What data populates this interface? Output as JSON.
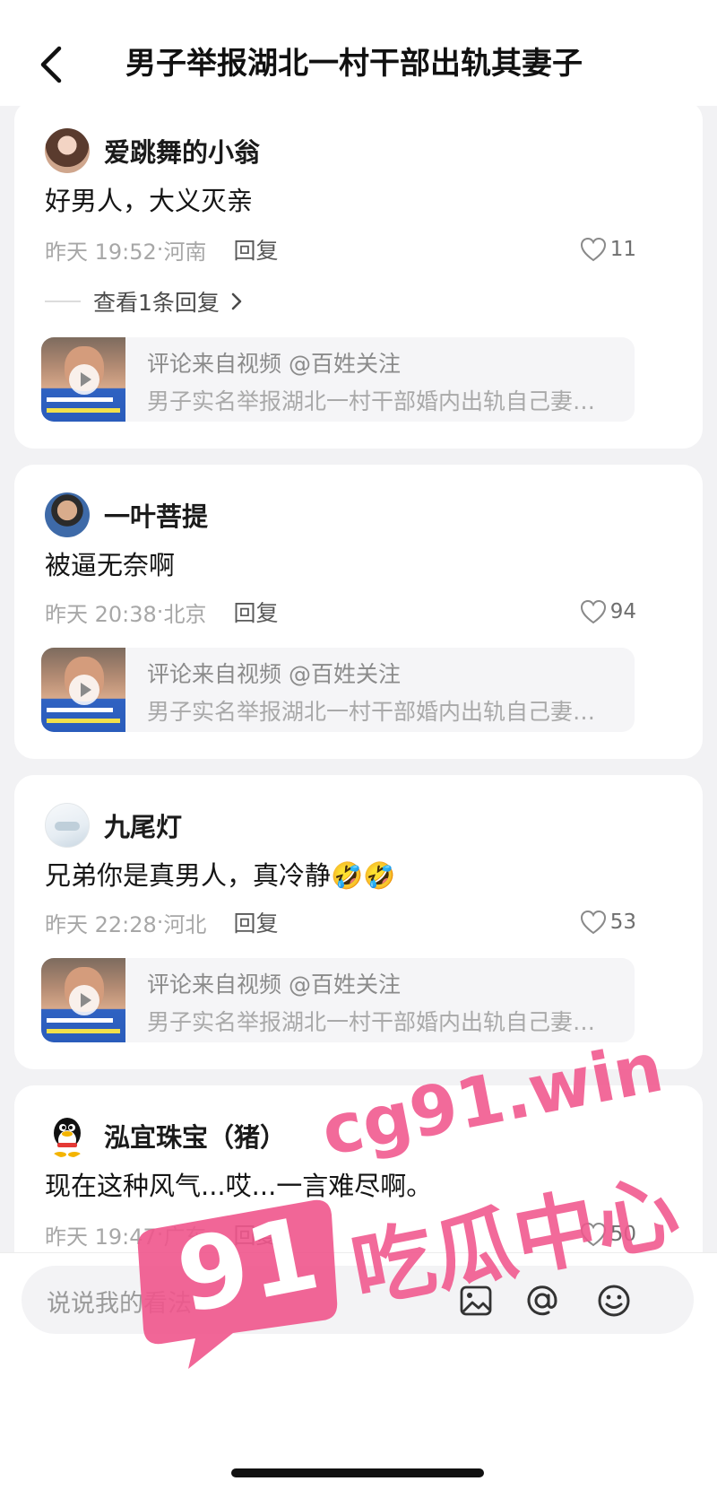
{
  "header": {
    "title": "男子举报湖北一村干部出轨其妻子"
  },
  "comments": [
    {
      "username": "爱跳舞的小翁",
      "text": "好男人，大义灭亲",
      "time": "昨天 19:52",
      "location": "河南",
      "reply_label": "回复",
      "likes": "11",
      "view_replies": "查看1条回复",
      "video_source": "评论来自视频 @百姓关注",
      "video_title": "男子实名举报湖北一村干部婚内出轨自己妻…"
    },
    {
      "username": "一叶菩提",
      "text": "被逼无奈啊",
      "time": "昨天 20:38",
      "location": "北京",
      "reply_label": "回复",
      "likes": "94",
      "video_source": "评论来自视频 @百姓关注",
      "video_title": "男子实名举报湖北一村干部婚内出轨自己妻…"
    },
    {
      "username": "九尾灯",
      "text": "兄弟你是真男人，真冷静🤣🤣",
      "time": "昨天 22:28",
      "location": "河北",
      "reply_label": "回复",
      "likes": "53",
      "video_source": "评论来自视频 @百姓关注",
      "video_title": "男子实名举报湖北一村干部婚内出轨自己妻…"
    },
    {
      "username": "泓宜珠宝（猪）",
      "text": "现在这种风气...哎...一言难尽啊。",
      "time": "昨天 19:47",
      "location": "广东",
      "reply_label": "回复",
      "likes": "50"
    }
  ],
  "bottom": {
    "placeholder": "说说我的看法"
  },
  "watermark": {
    "site": "cg91.win",
    "badge": "91",
    "text": "吃瓜中心"
  },
  "colors": {
    "background": "#f2f2f4",
    "card": "#ffffff",
    "watermark": "#f0558c"
  },
  "icons": [
    "back-arrow-icon",
    "heart-icon",
    "chevron-right-icon",
    "play-icon",
    "image-icon",
    "at-icon",
    "emoji-icon"
  ]
}
